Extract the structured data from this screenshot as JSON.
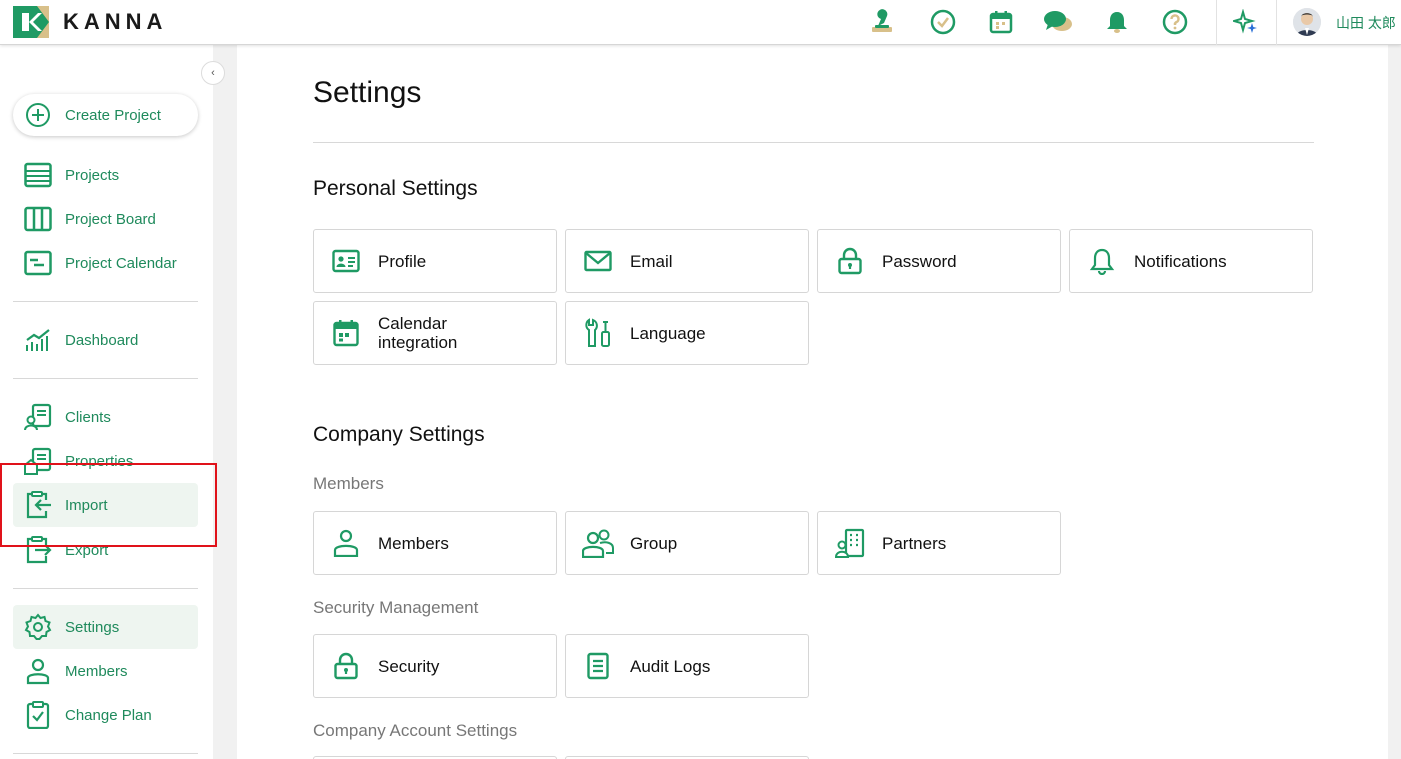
{
  "header": {
    "brand": "KANNA",
    "username": "山田 太郎"
  },
  "sidebar": {
    "create_label": "Create Project",
    "collapse_glyph": "‹",
    "items": [
      {
        "label": "Projects"
      },
      {
        "label": "Project Board"
      },
      {
        "label": "Project Calendar"
      },
      {
        "label": "Dashboard"
      },
      {
        "label": "Clients"
      },
      {
        "label": "Properties"
      },
      {
        "label": "Import"
      },
      {
        "label": "Export"
      },
      {
        "label": "Settings"
      },
      {
        "label": "Members"
      },
      {
        "label": "Change Plan"
      }
    ]
  },
  "main": {
    "title": "Settings",
    "personal": {
      "heading": "Personal Settings",
      "cards": [
        {
          "label": "Profile"
        },
        {
          "label": "Email"
        },
        {
          "label": "Password"
        },
        {
          "label": "Notifications"
        },
        {
          "label": "Calendar integration"
        },
        {
          "label": "Language"
        }
      ]
    },
    "company": {
      "heading": "Company Settings",
      "members_heading": "Members",
      "member_cards": [
        {
          "label": "Members"
        },
        {
          "label": "Group"
        },
        {
          "label": "Partners"
        }
      ],
      "security_heading": "Security Management",
      "security_cards": [
        {
          "label": "Security"
        },
        {
          "label": "Audit Logs"
        }
      ],
      "account_heading": "Company Account Settings"
    }
  },
  "theme": {
    "accent": "#1f9a64",
    "accent_text": "#1f8a5c",
    "active_bg": "#eef5f0",
    "highlight": "#e0121a"
  }
}
